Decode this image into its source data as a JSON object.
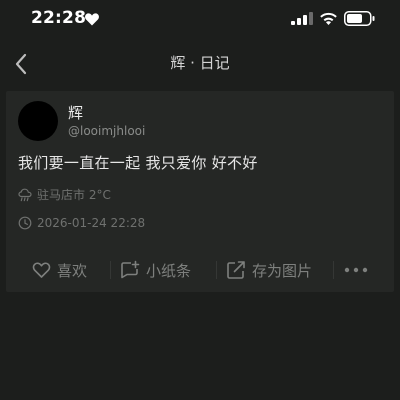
{
  "status_bar": {
    "time": "22:28",
    "icons": [
      "heart-icon",
      "signal-icon",
      "wifi-icon",
      "battery-icon"
    ]
  },
  "nav": {
    "title": "辉 · 日记",
    "back_icon": "chevron-left-icon"
  },
  "post": {
    "user_name": "辉",
    "user_handle": "@looimjhlooi",
    "content": "我们要一直在一起 我只爱你 好不好",
    "weather": "驻马店市 2°C",
    "timestamp": "2026-01-24 22:28"
  },
  "actions": {
    "like_label": "喜欢",
    "note_label": "小纸条",
    "save_label": "存为图片",
    "more_icon": "more-icon"
  },
  "colors": {
    "background": "#1c1e1c",
    "card": "#252725",
    "text_primary": "#e6e6e6",
    "text_muted": "#7e807e"
  }
}
